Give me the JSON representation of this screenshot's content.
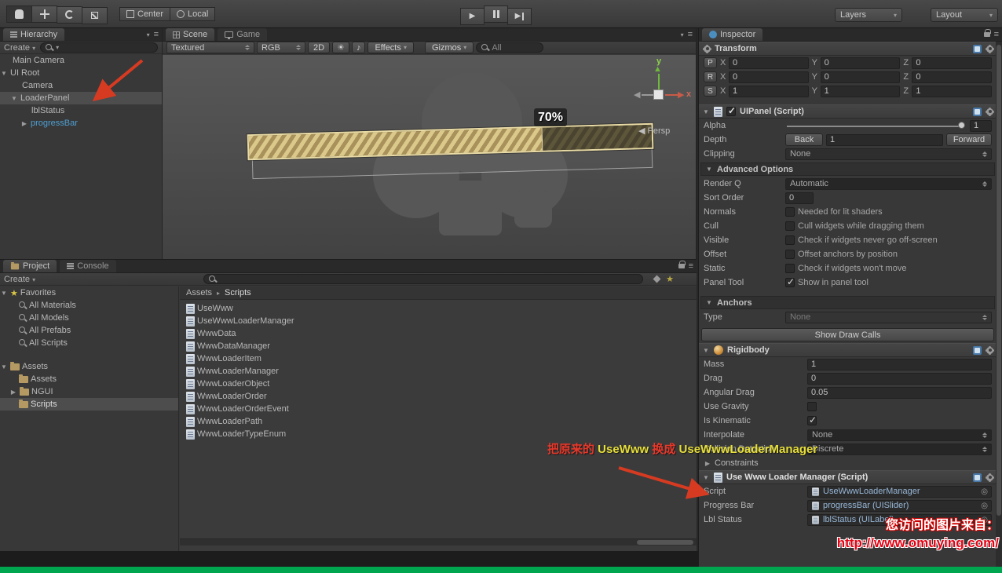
{
  "colors": {
    "note_red": "#e8382a",
    "note_yellow": "#e6de38",
    "green_bar": "#00a54f",
    "progress_fill_tan": "#dbc98b",
    "link_blue": "#4e9fd1",
    "arrow_red": "#d63b22"
  },
  "icons": {
    "fold_open": "▼",
    "fold_closed": "▶",
    "dropdown": "▾",
    "breadcrumb_sep": "▸",
    "check": "✓",
    "object_picker": "◎",
    "menu": "≡",
    "play": "▶",
    "axis_up": "▲",
    "axis_right": "▶",
    "axis_left": "◀",
    "star": "★",
    "sun": "☀",
    "audio": "♪"
  },
  "topbar": {
    "center": "Center",
    "local": "Local",
    "layers": "Layers",
    "layout": "Layout"
  },
  "hierarchy": {
    "tab": "Hierarchy",
    "create": "Create",
    "search_placeholder": "All",
    "items": [
      {
        "label": "Main Camera"
      },
      {
        "label": "UI Root"
      },
      {
        "label": "Camera"
      },
      {
        "label": "LoaderPanel"
      },
      {
        "label": "lblStatus"
      },
      {
        "label": "progressBar"
      }
    ]
  },
  "scene": {
    "tab_scene": "Scene",
    "tab_game": "Game",
    "shading": "Textured",
    "channels": "RGB",
    "mode2d": "2D",
    "effects": "Effects",
    "gizmos": "Gizmos",
    "search_text": "All",
    "progress_label": "70%",
    "axis_y": "y",
    "axis_x": "x",
    "persp": "Persp"
  },
  "project": {
    "tab_project": "Project",
    "tab_console": "Console",
    "create": "Create",
    "favorites_label": "Favorites",
    "favorites": [
      {
        "label": "All Materials"
      },
      {
        "label": "All Models"
      },
      {
        "label": "All Prefabs"
      },
      {
        "label": "All Scripts"
      }
    ],
    "assets_root": "Assets",
    "folders": [
      {
        "label": "Assets"
      },
      {
        "label": "NGUI"
      },
      {
        "label": "Scripts"
      }
    ],
    "breadcrumb_root": "Assets",
    "breadcrumb_current": "Scripts",
    "files": [
      {
        "name": "UseWww"
      },
      {
        "name": "UseWwwLoaderManager"
      },
      {
        "name": "WwwData"
      },
      {
        "name": "WwwDataManager"
      },
      {
        "name": "WwwLoaderItem"
      },
      {
        "name": "WwwLoaderManager"
      },
      {
        "name": "WwwLoaderObject"
      },
      {
        "name": "WwwLoaderOrder"
      },
      {
        "name": "WwwLoaderOrderEvent"
      },
      {
        "name": "WwwLoaderPath"
      },
      {
        "name": "WwwLoaderTypeEnum"
      }
    ]
  },
  "inspector": {
    "tab": "Inspector",
    "transform": {
      "title": "Transform",
      "axis": {
        "x": "X",
        "y": "Y",
        "z": "Z"
      },
      "rows": [
        {
          "key": "P",
          "x": "0",
          "y": "0",
          "z": "0"
        },
        {
          "key": "R",
          "x": "0",
          "y": "0",
          "z": "0"
        },
        {
          "key": "S",
          "x": "1",
          "y": "1",
          "z": "1"
        }
      ]
    },
    "uipanel": {
      "title": "UIPanel (Script)",
      "alpha_label": "Alpha",
      "alpha_value": "1",
      "depth_label": "Depth",
      "back": "Back",
      "depth_value": "1",
      "forward": "Forward",
      "clipping_label": "Clipping",
      "clipping_value": "None",
      "advanced_title": "Advanced Options",
      "render_q_label": "Render Q",
      "render_q_value": "Automatic",
      "sort_order_label": "Sort Order",
      "sort_order_value": "0",
      "options": [
        {
          "label": "Normals",
          "desc": "Needed for lit shaders"
        },
        {
          "label": "Cull",
          "desc": "Cull widgets while dragging them"
        },
        {
          "label": "Visible",
          "desc": "Check if widgets never go off-screen"
        },
        {
          "label": "Offset",
          "desc": "Offset anchors by position"
        },
        {
          "label": "Static",
          "desc": "Check if widgets won't move"
        },
        {
          "label": "Panel Tool",
          "desc": "Show in panel tool"
        }
      ],
      "anchors_title": "Anchors",
      "type_label": "Type",
      "type_value": "None",
      "show_draw_calls": "Show Draw Calls"
    },
    "rigidbody": {
      "title": "Rigidbody",
      "mass_label": "Mass",
      "mass": "1",
      "drag_label": "Drag",
      "drag": "0",
      "angular_label": "Angular Drag",
      "angular": "0.05",
      "gravity_label": "Use Gravity",
      "kinematic_label": "Is Kinematic",
      "interpolate_label": "Interpolate",
      "interpolate": "None",
      "collision_label": "Collision Detection",
      "collision": "Discrete",
      "constraints_label": "Constraints"
    },
    "loader": {
      "title": "Use Www Loader Manager (Script)",
      "script_label": "Script",
      "script_value": "UseWwwLoaderManager",
      "progress_label": "Progress Bar",
      "progress_value": "progressBar (UISlider)",
      "status_label": "Lbl Status",
      "status_value": "lblStatus (UILabel)"
    }
  },
  "annotations": {
    "note": [
      {
        "text": "把原来的 "
      },
      {
        "text": "UseWww"
      },
      {
        "text": " 换成 "
      },
      {
        "text": "UseWwwLoaderManager"
      }
    ],
    "watermark_line1": "您访问的图片来自：",
    "watermark_line2": "http://www.omuying.com/"
  }
}
